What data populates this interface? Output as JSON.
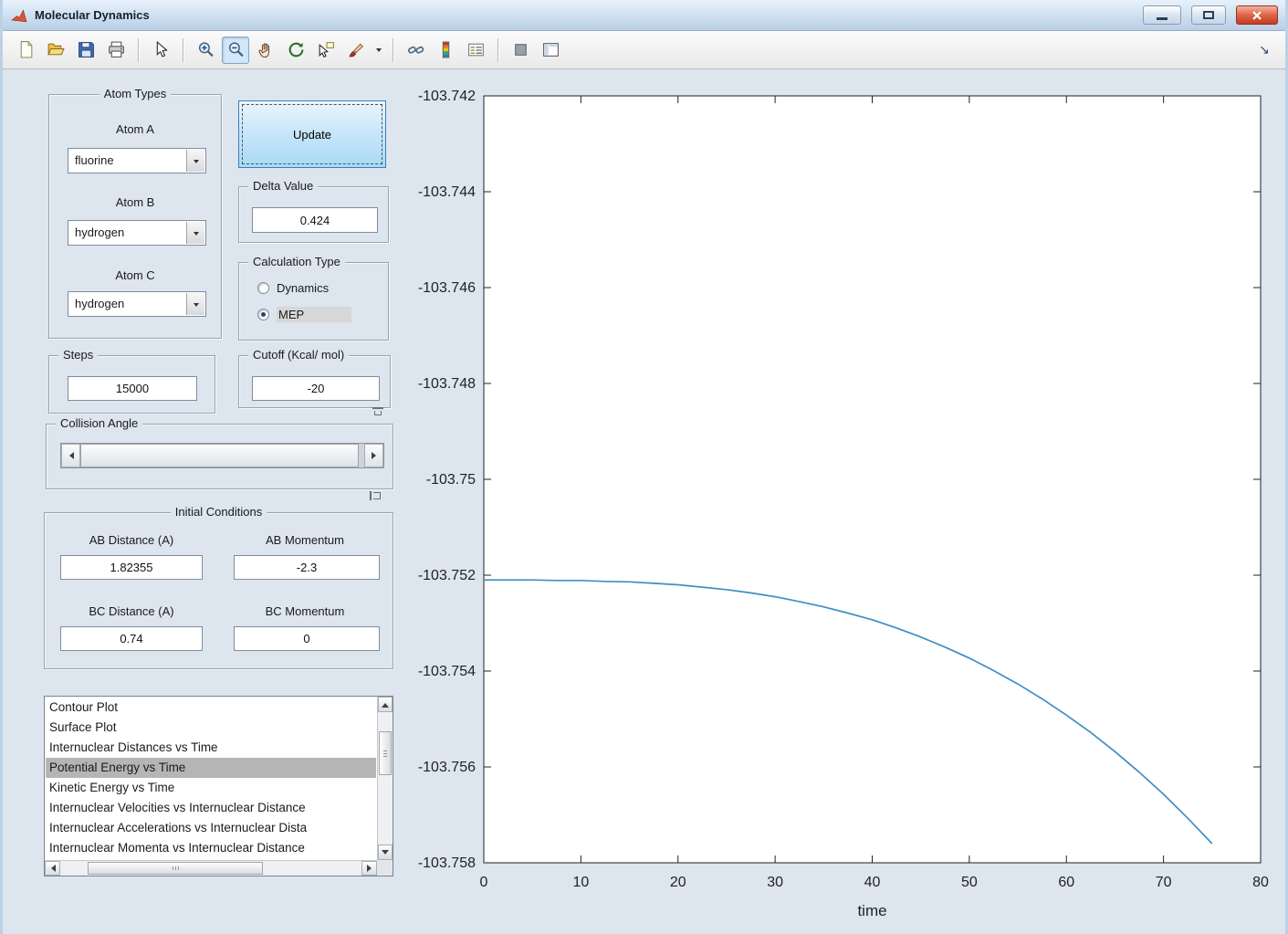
{
  "window": {
    "title": "Molecular Dynamics"
  },
  "toolbar": {
    "icons": [
      "new-figure",
      "open-file",
      "save-figure",
      "print-figure",
      "edit-plot",
      "zoom-in",
      "zoom-out",
      "pan",
      "rotate-3d",
      "data-cursor",
      "brush-data",
      "brush-dropdown",
      "link-plot",
      "insert-colorbar",
      "insert-legend",
      "hide-plot-tools",
      "show-plot-tools",
      "dock-figure"
    ],
    "active_icon": "zoom-out"
  },
  "controls": {
    "atom_types": {
      "title": "Atom Types",
      "fields": [
        {
          "label": "Atom A",
          "value": "fluorine"
        },
        {
          "label": "Atom B",
          "value": "hydrogen"
        },
        {
          "label": "Atom C",
          "value": "hydrogen"
        }
      ]
    },
    "update": {
      "label": "Update"
    },
    "delta": {
      "title": "Delta Value",
      "value": "0.424"
    },
    "calc_type": {
      "title": "Calculation Type",
      "options": [
        {
          "label": "Dynamics",
          "selected": false
        },
        {
          "label": "MEP",
          "selected": true
        }
      ]
    },
    "steps": {
      "title": "Steps",
      "value": "15000"
    },
    "cutoff": {
      "title": "Cutoff (Kcal/ mol)",
      "value": "-20"
    },
    "collision": {
      "title": "Collision Angle"
    },
    "initial": {
      "title": "Initial Conditions",
      "fields": [
        {
          "label": "AB Distance (A)",
          "value": "1.82355"
        },
        {
          "label": "AB Momentum",
          "value": "-2.3"
        },
        {
          "label": "BC Distance (A)",
          "value": "0.74"
        },
        {
          "label": "BC Momentum",
          "value": "0"
        }
      ]
    },
    "plot_list": {
      "items": [
        "Contour Plot",
        "Surface Plot",
        "Internuclear Distances vs Time",
        "Potential Energy vs Time",
        "Kinetic Energy vs Time",
        "Internuclear Velocities vs Internuclear Distance",
        "Internuclear Accelerations vs Internuclear Dista",
        "Internuclear Momenta vs Internuclear Distance"
      ],
      "selected_index": 3
    }
  },
  "chart_data": {
    "type": "line",
    "title": "",
    "xlabel": "time",
    "ylabel": "",
    "xlim": [
      0,
      80
    ],
    "ylim": [
      -103.758,
      -103.742
    ],
    "xtick_values": [
      0,
      10,
      20,
      30,
      40,
      50,
      60,
      70,
      80
    ],
    "xtick_labels": [
      "0",
      "10",
      "20",
      "30",
      "40",
      "50",
      "60",
      "70",
      "80"
    ],
    "ytick_values": [
      -103.742,
      -103.744,
      -103.746,
      -103.748,
      -103.75,
      -103.752,
      -103.754,
      -103.756,
      -103.758
    ],
    "ytick_labels": [
      "-103.742",
      "-103.744",
      "-103.746",
      "-103.748",
      "-103.75",
      "-103.752",
      "-103.754",
      "-103.756",
      "-103.758"
    ],
    "line_color": "#3f8fc5",
    "x": [
      0,
      2.5,
      5,
      7.5,
      10,
      12.5,
      15,
      17.5,
      20,
      22.5,
      25,
      27.5,
      30,
      32.5,
      35,
      37.5,
      40,
      42.5,
      45,
      47.5,
      50,
      52.5,
      55,
      57.5,
      60,
      62.5,
      65,
      67.5,
      70,
      72.5,
      75
    ],
    "y": [
      -103.7521,
      -103.7521,
      -103.7521,
      -103.75211,
      -103.75211,
      -103.75213,
      -103.75214,
      -103.75217,
      -103.7522,
      -103.75225,
      -103.7523,
      -103.75237,
      -103.75245,
      -103.75255,
      -103.75266,
      -103.75279,
      -103.75293,
      -103.7531,
      -103.75329,
      -103.7535,
      -103.75373,
      -103.75399,
      -103.75427,
      -103.75458,
      -103.75492,
      -103.75528,
      -103.75568,
      -103.75611,
      -103.75657,
      -103.75707,
      -103.7576
    ]
  }
}
